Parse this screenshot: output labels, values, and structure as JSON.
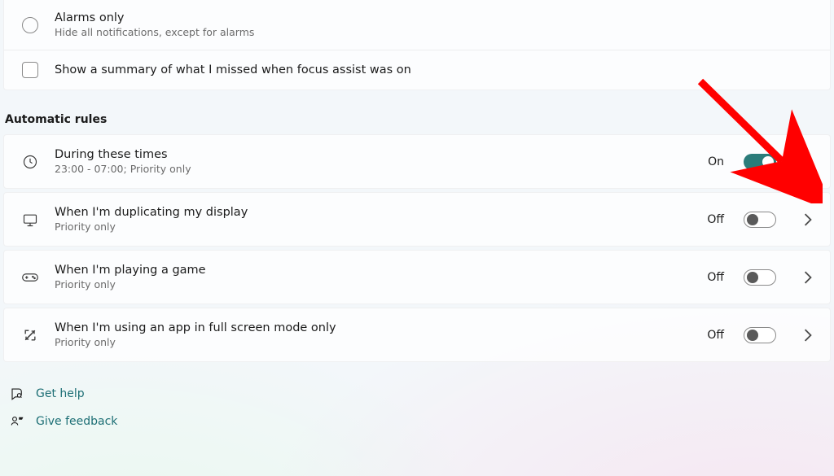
{
  "top_options": {
    "alarms_only": {
      "label": "Alarms only",
      "description": "Hide all notifications, except for alarms"
    },
    "show_summary": {
      "label": "Show a summary of what I missed when focus assist was on",
      "checked": false
    }
  },
  "section_heading": "Automatic rules",
  "rules": {
    "during_times": {
      "title": "During these times",
      "subtitle": "23:00 - 07:00; Priority only",
      "state_label": "On",
      "on": true
    },
    "duplicating": {
      "title": "When I'm duplicating my display",
      "subtitle": "Priority only",
      "state_label": "Off",
      "on": false
    },
    "playing_game": {
      "title": "When I'm playing a game",
      "subtitle": "Priority only",
      "state_label": "Off",
      "on": false
    },
    "fullscreen_app": {
      "title": "When I'm using an app in full screen mode only",
      "subtitle": "Priority only",
      "state_label": "Off",
      "on": false
    }
  },
  "footer": {
    "get_help": "Get help",
    "give_feedback": "Give feedback"
  }
}
